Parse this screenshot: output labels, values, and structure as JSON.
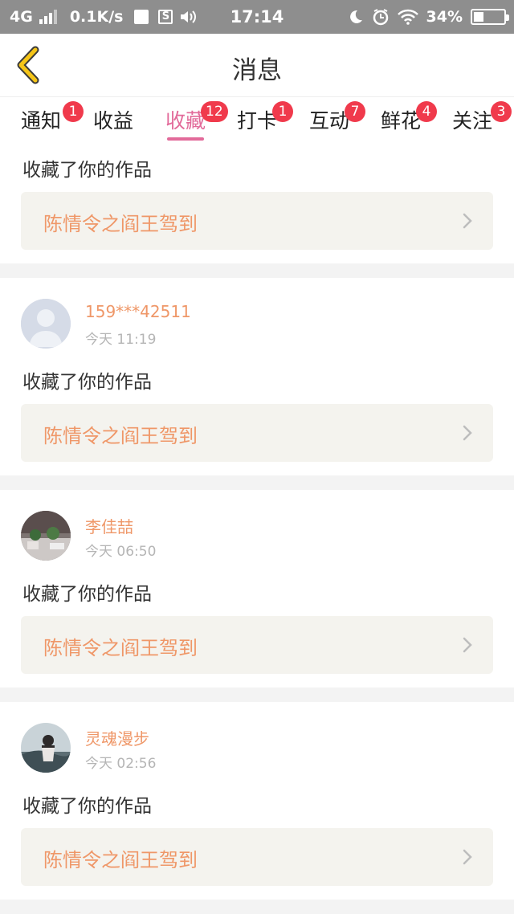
{
  "status_bar": {
    "network": "4G",
    "speed": "0.1K/s",
    "time": "17:14",
    "battery_percent": "34%",
    "battery_level": 0.34,
    "icons": [
      "signal-icon",
      "mail-icon",
      "s-app-icon",
      "volume-icon",
      "moon-icon",
      "alarm-icon",
      "wifi-icon",
      "battery-icon"
    ]
  },
  "nav": {
    "title": "消息",
    "back_icon": "chevron-left-icon",
    "accent_color": "#f5c518"
  },
  "tabs": [
    {
      "label": "通知",
      "badge": "1"
    },
    {
      "label": "收益",
      "badge": ""
    },
    {
      "label": "收藏",
      "badge": "12",
      "active": true
    },
    {
      "label": "打卡",
      "badge": "1"
    },
    {
      "label": "互动",
      "badge": "7"
    },
    {
      "label": "鲜花",
      "badge": "4"
    },
    {
      "label": "关注",
      "badge": "3"
    }
  ],
  "colors": {
    "active_tab": "#e26a9a",
    "badge": "#f03a4c",
    "username": "#ef9768",
    "work_title": "#ef9768"
  },
  "messages": [
    {
      "user": "",
      "time": "",
      "action": "收藏了你的作品",
      "work": "陈情令之阎王驾到"
    },
    {
      "user": "159***42511",
      "time": "今天 11:19",
      "action": "收藏了你的作品",
      "work": "陈情令之阎王驾到",
      "avatar": "default-avatar"
    },
    {
      "user": "李佳喆",
      "time": "今天 06:50",
      "action": "收藏了你的作品",
      "work": "陈情令之阎王驾到",
      "avatar": "photo-avatar"
    },
    {
      "user": "灵魂漫步",
      "time": "今天 02:56",
      "action": "收藏了你的作品",
      "work": "陈情令之阎王驾到",
      "avatar": "photo-avatar"
    }
  ]
}
